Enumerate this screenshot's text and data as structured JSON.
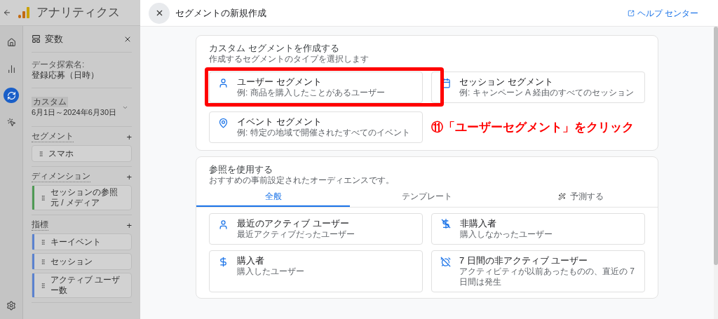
{
  "app_bar": {
    "title": "アナリティクス"
  },
  "nav_rail": [
    {
      "selected": false
    },
    {
      "selected": false
    },
    {
      "selected": true
    },
    {
      "selected": false
    }
  ],
  "variables_panel": {
    "title": "変数",
    "exploration_label": "データ探索名:",
    "exploration_name": "登録応募（日時）",
    "date_range": {
      "label": "カスタム",
      "value": "6月1日～2024年6月30日"
    },
    "sections": [
      {
        "title": "セグメント",
        "plus": "+",
        "items": [
          {
            "label": "スマホ"
          }
        ]
      },
      {
        "title": "ディメンション",
        "plus": "+",
        "items": [
          {
            "label": "セッションの参照元 / メディア",
            "color": "#4f9a55"
          }
        ]
      },
      {
        "title": "指標",
        "plus": "+",
        "items": [
          {
            "label": "キーイベント",
            "color": "#5b82cf"
          },
          {
            "label": "セッション",
            "color": "#5b82cf"
          },
          {
            "label": "アクティブ ユーザー数",
            "color": "#5b82cf"
          }
        ]
      }
    ]
  },
  "modal": {
    "title": "セグメントの新規作成",
    "help_link": "ヘルプ センター",
    "custom_card": {
      "title": "カスタム セグメントを作成する",
      "subtitle": "作成するセグメントのタイプを選択します",
      "options": [
        {
          "title": "ユーザー セグメント",
          "description": "例: 商品を購入したことがあるユーザー"
        },
        {
          "title": "セッション セグメント",
          "description": "例: キャンペーン A 経由のすべてのセッション"
        },
        {
          "title": "イベント セグメント",
          "description": "例: 特定の地域で開催されたすべてのイベント"
        }
      ]
    },
    "reference_card": {
      "title": "参照を使用する",
      "subtitle": "おすすめの事前設定されたオーディエンスです。",
      "tabs": [
        {
          "label": "全般",
          "selected": true
        },
        {
          "label": "テンプレート",
          "selected": false
        },
        {
          "label": "予測する",
          "selected": false
        }
      ],
      "options": [
        {
          "title": "最近のアクティブ ユーザー",
          "description": "最近アクティブだったユーザー"
        },
        {
          "title": "非購入者",
          "description": "購入しなかったユーザー"
        },
        {
          "title": "購入者",
          "description": "購入したユーザー"
        },
        {
          "title": "7 日間の非アクティブ ユーザー",
          "description": "アクティビティが以前あったものの、直近の 7 日間は発生"
        }
      ]
    }
  },
  "annotation": {
    "text": "⑪「ユーザーセグメント」をクリック"
  }
}
